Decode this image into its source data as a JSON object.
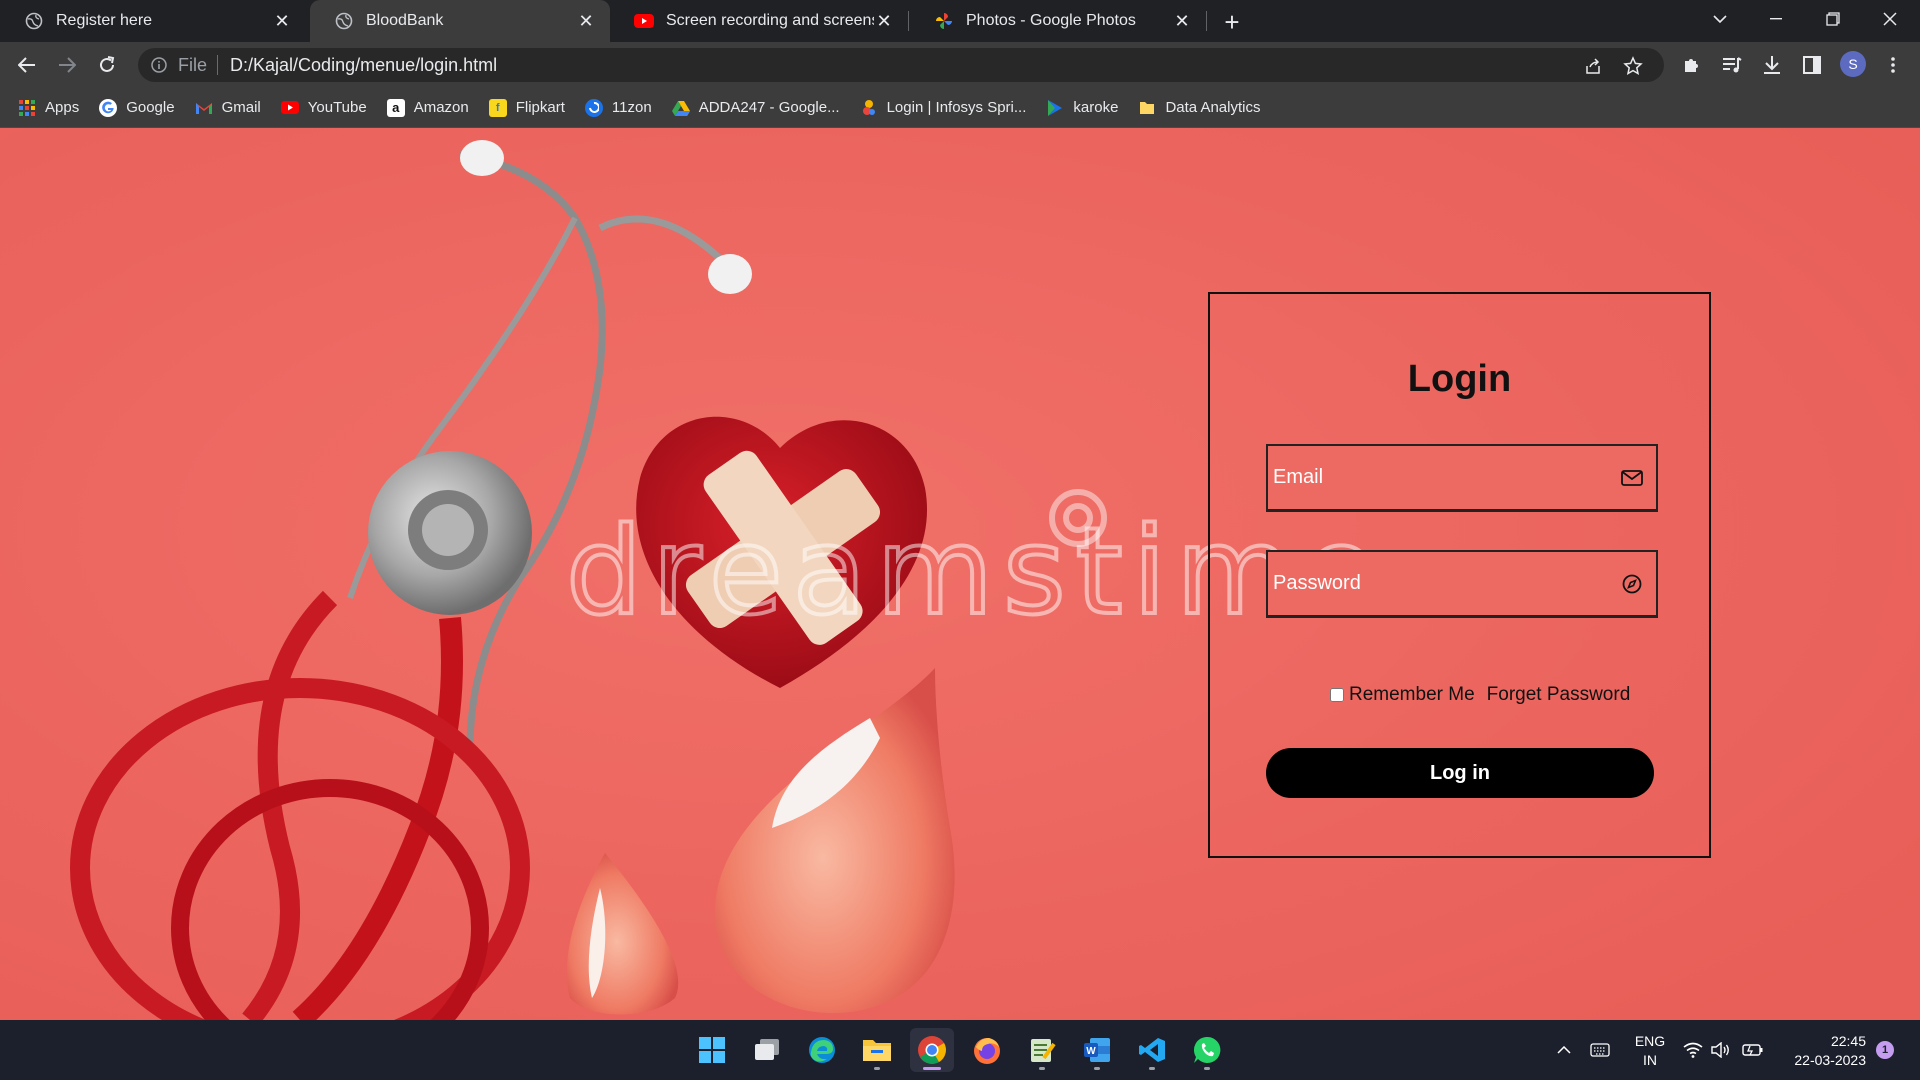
{
  "browser": {
    "tabs": [
      {
        "title": "Register here",
        "icon": "globe-icon",
        "active": false
      },
      {
        "title": "BloodBank",
        "icon": "globe-icon",
        "active": true
      },
      {
        "title": "Screen recording and screenshot",
        "icon": "youtube-icon",
        "active": false
      },
      {
        "title": "Photos - Google Photos",
        "icon": "google-photos-icon",
        "active": false
      }
    ],
    "new_tab_label": "+",
    "address": {
      "scheme": "File",
      "url": "D:/Kajal/Coding/menue/login.html"
    },
    "profile_initial": "S",
    "bookmarks": [
      {
        "label": "Apps",
        "icon": "apps-grid-icon"
      },
      {
        "label": "Google",
        "icon": "google-icon"
      },
      {
        "label": "Gmail",
        "icon": "gmail-icon"
      },
      {
        "label": "YouTube",
        "icon": "youtube-icon"
      },
      {
        "label": "Amazon",
        "icon": "amazon-icon"
      },
      {
        "label": "Flipkart",
        "icon": "flipkart-icon"
      },
      {
        "label": "11zon",
        "icon": "11zon-icon"
      },
      {
        "label": "ADDA247 - Google...",
        "icon": "google-drive-icon"
      },
      {
        "label": "Login | Infosys Spri...",
        "icon": "infosys-springboard-icon"
      },
      {
        "label": "karoke",
        "icon": "play-icon"
      },
      {
        "label": "Data Analytics",
        "icon": "folder-icon"
      }
    ]
  },
  "page": {
    "watermark": "dreamstime",
    "login": {
      "title": "Login",
      "email_placeholder": "Email",
      "password_placeholder": "Password",
      "remember_label": "Remember Me",
      "forget_label": "Forget Password",
      "submit_label": "Log in"
    }
  },
  "taskbar": {
    "apps": [
      "windows-start",
      "task-view",
      "edge",
      "file-explorer",
      "chrome",
      "firefox",
      "notepad",
      "word",
      "vscode",
      "whatsapp"
    ],
    "lang_primary": "ENG",
    "lang_secondary": "IN",
    "time": "22:45",
    "date": "22-03-2023",
    "notification_count": "1"
  },
  "colors": {
    "page_background": "#ee6a62",
    "button": "#000000",
    "chrome_dark": "#202124",
    "taskbar": "#1c1f2c"
  }
}
